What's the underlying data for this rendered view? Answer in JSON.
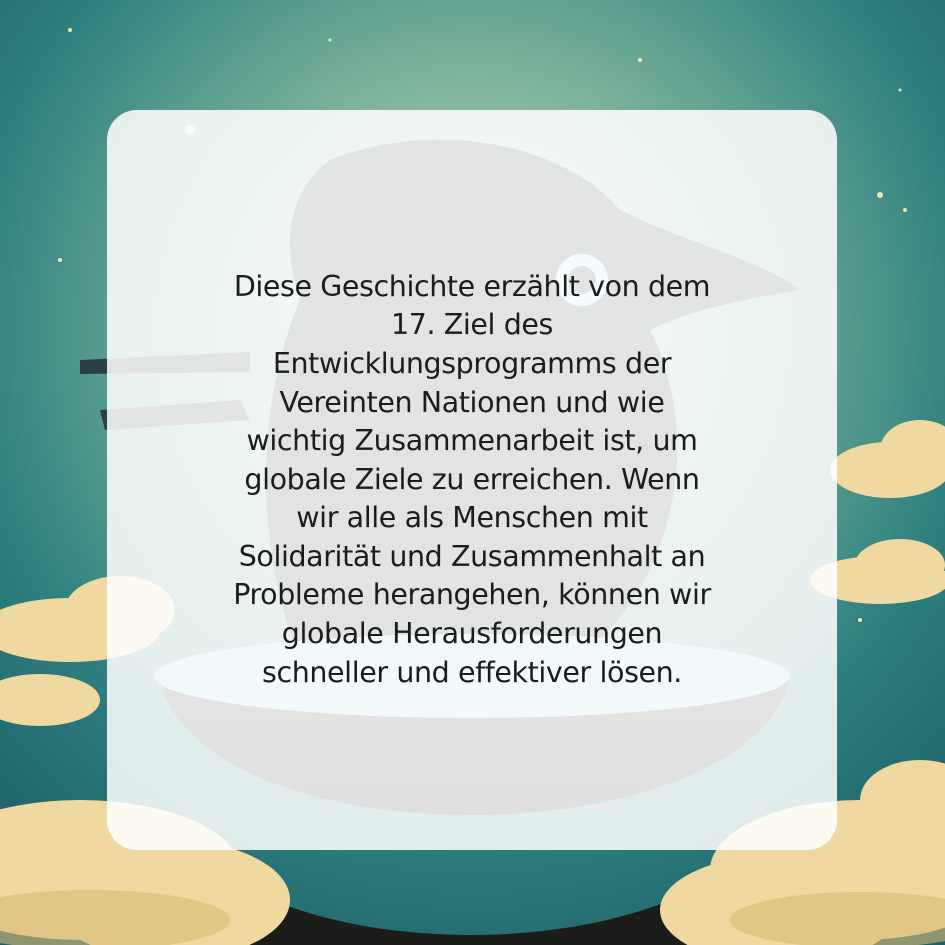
{
  "background": {
    "colors": {
      "sky_top": "#1f6f74",
      "sky_mid": "#3f8f86",
      "glow": "#cfe0b8",
      "cloud": "#f0d9a0",
      "cloud_shadow": "#d9b978",
      "bird": "#2a3e44",
      "bowl": "#2b2b28",
      "water": "#9fd6dc",
      "star": "#f5e6a8"
    },
    "illustration_icon": "bird-on-bowl-illustration"
  },
  "card": {
    "background": "#ffffff",
    "text": "Diese Geschichte erzählt von dem\n17. Ziel des\nEntwicklungsprogramms der\nVereinten Nationen und wie\nwichtig Zusammenarbeit ist, um\nglobale Ziele zu erreichen. Wenn\nwir alle als Menschen mit\nSolidarität und Zusammenhalt an\nProbleme herangehen, können wir\nglobale Herausforderungen\nschneller und effektiver lösen."
  }
}
